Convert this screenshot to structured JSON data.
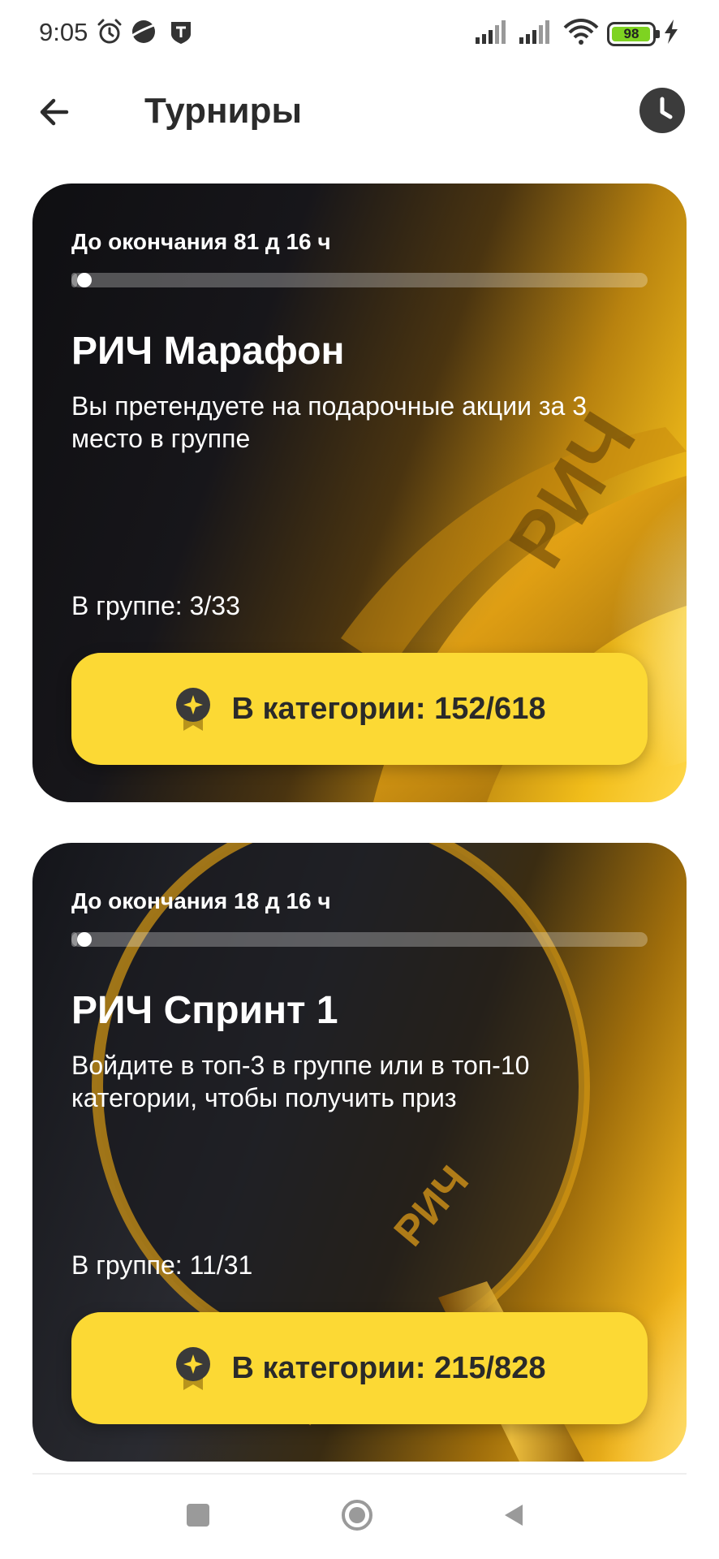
{
  "status_bar": {
    "time": "9:05",
    "battery": "98",
    "battery_level": 0.98,
    "icons": [
      "alarm-icon",
      "planet-icon",
      "shield-app-icon",
      "signal-icon",
      "signal-icon",
      "wifi-icon",
      "battery-icon",
      "charging-icon"
    ]
  },
  "header": {
    "title": "Турниры",
    "back_icon": "arrow-left-icon",
    "history_icon": "clock-icon"
  },
  "tournaments": [
    {
      "deadline": "До окончания 81 д 16 ч",
      "progress": 0.01,
      "title": "РИЧ Марафон",
      "description": "Вы претендуете на подарочные акции за 3 место в группе",
      "group_rank": "В группе: 3/33",
      "category_label": "В категории: 152/618"
    },
    {
      "deadline": "До окончания 18 д 16 ч",
      "progress": 0.01,
      "title": "РИЧ Спринт 1",
      "description": "Войдите в топ-3 в группе или в топ-10 категории, чтобы получить приз",
      "group_rank": "В группе: 11/31",
      "category_label": "В категории: 215/828"
    }
  ],
  "colors": {
    "accent_yellow": "#fcd934",
    "card_dark": "#141418",
    "gold": "#f1bd1a"
  },
  "nav_bar": {
    "icons": [
      "square-icon",
      "circle-home-icon",
      "triangle-back-icon"
    ]
  }
}
